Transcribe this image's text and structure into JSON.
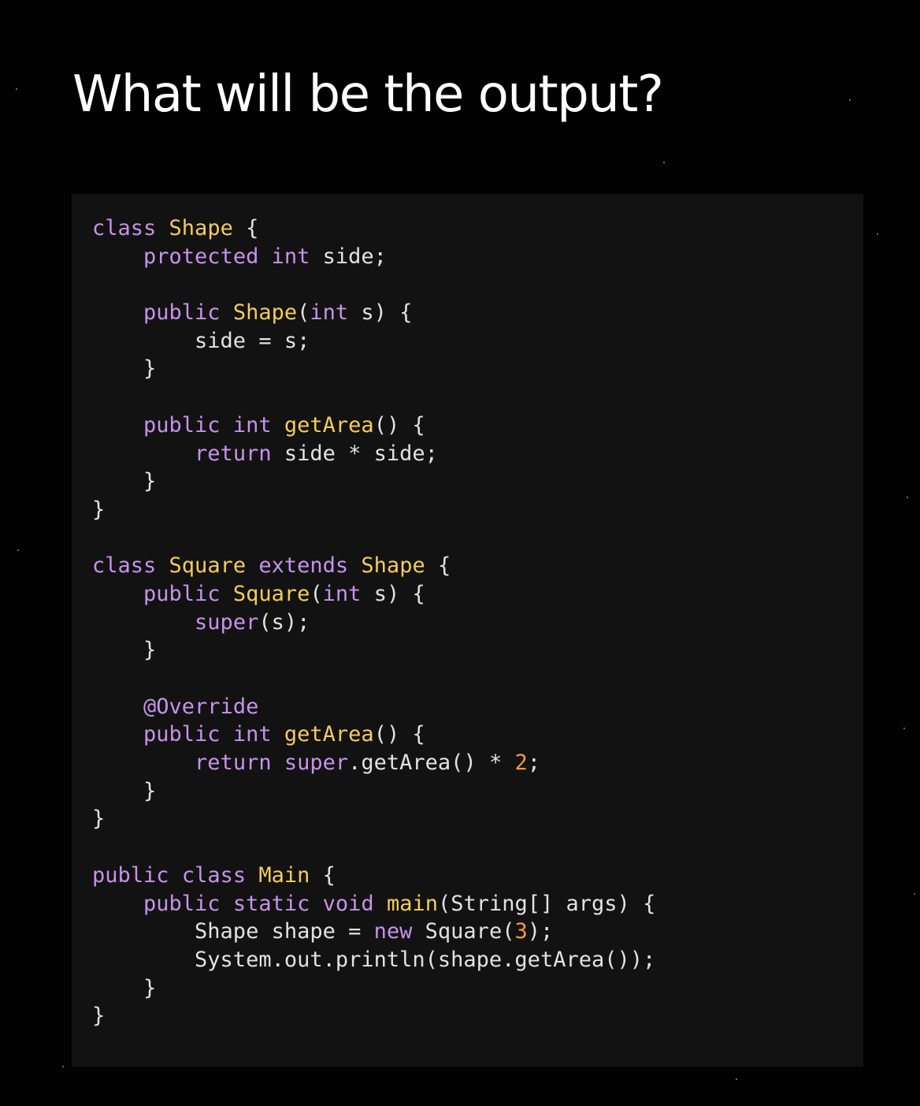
{
  "title": "What will be the output?",
  "colors": {
    "background": "#020202",
    "code_panel": "#121212",
    "keyword": "#c792ea",
    "function": "#f4cc5a",
    "text": "#e2e2e2",
    "number": "#f39a3f"
  },
  "code": {
    "language": "java",
    "lines": [
      [
        {
          "t": "kw",
          "s": "class"
        },
        {
          "t": "txt",
          "s": " "
        },
        {
          "t": "fn",
          "s": "Shape"
        },
        {
          "t": "txt",
          "s": " {"
        }
      ],
      [
        {
          "t": "txt",
          "s": "    "
        },
        {
          "t": "kw",
          "s": "protected"
        },
        {
          "t": "txt",
          "s": " "
        },
        {
          "t": "kw",
          "s": "int"
        },
        {
          "t": "txt",
          "s": " side;"
        }
      ],
      [],
      [
        {
          "t": "txt",
          "s": "    "
        },
        {
          "t": "kw",
          "s": "public"
        },
        {
          "t": "txt",
          "s": " "
        },
        {
          "t": "fn",
          "s": "Shape"
        },
        {
          "t": "txt",
          "s": "("
        },
        {
          "t": "kw",
          "s": "int"
        },
        {
          "t": "txt",
          "s": " s) {"
        }
      ],
      [
        {
          "t": "txt",
          "s": "        side = s;"
        }
      ],
      [
        {
          "t": "txt",
          "s": "    }"
        }
      ],
      [],
      [
        {
          "t": "txt",
          "s": "    "
        },
        {
          "t": "kw",
          "s": "public"
        },
        {
          "t": "txt",
          "s": " "
        },
        {
          "t": "kw",
          "s": "int"
        },
        {
          "t": "txt",
          "s": " "
        },
        {
          "t": "fn",
          "s": "getArea"
        },
        {
          "t": "txt",
          "s": "() {"
        }
      ],
      [
        {
          "t": "txt",
          "s": "        "
        },
        {
          "t": "kw",
          "s": "return"
        },
        {
          "t": "txt",
          "s": " side * side;"
        }
      ],
      [
        {
          "t": "txt",
          "s": "    }"
        }
      ],
      [
        {
          "t": "txt",
          "s": "}"
        }
      ],
      [],
      [
        {
          "t": "kw",
          "s": "class"
        },
        {
          "t": "txt",
          "s": " "
        },
        {
          "t": "fn",
          "s": "Square"
        },
        {
          "t": "txt",
          "s": " "
        },
        {
          "t": "kw",
          "s": "extends"
        },
        {
          "t": "txt",
          "s": " "
        },
        {
          "t": "fn",
          "s": "Shape"
        },
        {
          "t": "txt",
          "s": " {"
        }
      ],
      [
        {
          "t": "txt",
          "s": "    "
        },
        {
          "t": "kw",
          "s": "public"
        },
        {
          "t": "txt",
          "s": " "
        },
        {
          "t": "fn",
          "s": "Square"
        },
        {
          "t": "txt",
          "s": "("
        },
        {
          "t": "kw",
          "s": "int"
        },
        {
          "t": "txt",
          "s": " s) {"
        }
      ],
      [
        {
          "t": "txt",
          "s": "        "
        },
        {
          "t": "kw",
          "s": "super"
        },
        {
          "t": "txt",
          "s": "(s);"
        }
      ],
      [
        {
          "t": "txt",
          "s": "    }"
        }
      ],
      [],
      [
        {
          "t": "txt",
          "s": "    "
        },
        {
          "t": "kw",
          "s": "@Override"
        }
      ],
      [
        {
          "t": "txt",
          "s": "    "
        },
        {
          "t": "kw",
          "s": "public"
        },
        {
          "t": "txt",
          "s": " "
        },
        {
          "t": "kw",
          "s": "int"
        },
        {
          "t": "txt",
          "s": " "
        },
        {
          "t": "fn",
          "s": "getArea"
        },
        {
          "t": "txt",
          "s": "() {"
        }
      ],
      [
        {
          "t": "txt",
          "s": "        "
        },
        {
          "t": "kw",
          "s": "return"
        },
        {
          "t": "txt",
          "s": " "
        },
        {
          "t": "kw",
          "s": "super"
        },
        {
          "t": "txt",
          "s": ".getArea() * "
        },
        {
          "t": "num",
          "s": "2"
        },
        {
          "t": "txt",
          "s": ";"
        }
      ],
      [
        {
          "t": "txt",
          "s": "    }"
        }
      ],
      [
        {
          "t": "txt",
          "s": "}"
        }
      ],
      [],
      [
        {
          "t": "kw",
          "s": "public"
        },
        {
          "t": "txt",
          "s": " "
        },
        {
          "t": "kw",
          "s": "class"
        },
        {
          "t": "txt",
          "s": " "
        },
        {
          "t": "fn",
          "s": "Main"
        },
        {
          "t": "txt",
          "s": " {"
        }
      ],
      [
        {
          "t": "txt",
          "s": "    "
        },
        {
          "t": "kw",
          "s": "public"
        },
        {
          "t": "txt",
          "s": " "
        },
        {
          "t": "kw",
          "s": "static"
        },
        {
          "t": "txt",
          "s": " "
        },
        {
          "t": "kw",
          "s": "void"
        },
        {
          "t": "txt",
          "s": " "
        },
        {
          "t": "fn",
          "s": "main"
        },
        {
          "t": "txt",
          "s": "(String[] args) {"
        }
      ],
      [
        {
          "t": "txt",
          "s": "        Shape shape = "
        },
        {
          "t": "kw",
          "s": "new"
        },
        {
          "t": "txt",
          "s": " Square("
        },
        {
          "t": "num",
          "s": "3"
        },
        {
          "t": "txt",
          "s": ");"
        }
      ],
      [
        {
          "t": "txt",
          "s": "        System.out.println(shape.getArea());"
        }
      ],
      [
        {
          "t": "txt",
          "s": "    }"
        }
      ],
      [
        {
          "t": "txt",
          "s": "}"
        }
      ]
    ]
  }
}
